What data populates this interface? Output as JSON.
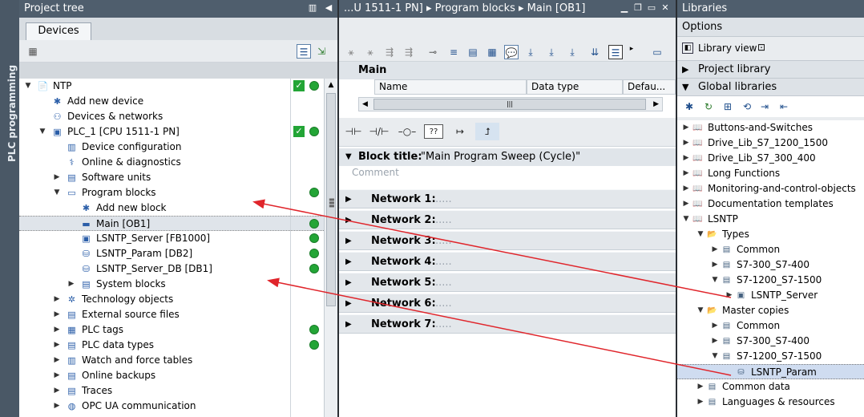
{
  "side_tab": "PLC programming",
  "project_tree": {
    "title": "Project tree",
    "tab": "Devices",
    "rows": [
      {
        "label": "NTP"
      },
      {
        "label": "Add new device"
      },
      {
        "label": "Devices & networks"
      },
      {
        "label": "PLC_1 [CPU 1511-1 PN]"
      },
      {
        "label": "Device configuration"
      },
      {
        "label": "Online & diagnostics"
      },
      {
        "label": "Software units"
      },
      {
        "label": "Program blocks"
      },
      {
        "label": "Add new block"
      },
      {
        "label": "Main [OB1]"
      },
      {
        "label": "LSNTP_Server [FB1000]"
      },
      {
        "label": "LSNTP_Param [DB2]"
      },
      {
        "label": "LSNTP_Server_DB [DB1]"
      },
      {
        "label": "System blocks"
      },
      {
        "label": "Technology objects"
      },
      {
        "label": "External source files"
      },
      {
        "label": "PLC tags"
      },
      {
        "label": "PLC data types"
      },
      {
        "label": "Watch and force tables"
      },
      {
        "label": "Online backups"
      },
      {
        "label": "Traces"
      },
      {
        "label": "OPC UA communication"
      }
    ]
  },
  "editor": {
    "breadcrumb": "...U 1511-1 PN]  ▸ Program blocks  ▸ Main [OB1]",
    "block": "Main",
    "columns": [
      "Name",
      "Data type",
      "Defau..."
    ],
    "block_title_label": "Block title:",
    "block_title_value": "\"Main Program Sweep (Cycle)\"",
    "comment": "Comment",
    "networks": [
      {
        "label": "Network 1:",
        "dots": "....."
      },
      {
        "label": "Network 2:",
        "dots": "....."
      },
      {
        "label": "Network 3:",
        "dots": "....."
      },
      {
        "label": "Network 4:",
        "dots": "....."
      },
      {
        "label": "Network 5:",
        "dots": "....."
      },
      {
        "label": "Network 6:",
        "dots": "....."
      },
      {
        "label": "Network 7:",
        "dots": "....."
      }
    ]
  },
  "libraries": {
    "title": "Libraries",
    "options": "Options",
    "library_view": "Library view",
    "project_library": "Project library",
    "global_libraries": "Global libraries",
    "rows": [
      {
        "label": "Buttons-and-Switches"
      },
      {
        "label": "Drive_Lib_S7_1200_1500"
      },
      {
        "label": "Drive_Lib_S7_300_400"
      },
      {
        "label": "Long Functions"
      },
      {
        "label": "Monitoring-and-control-objects"
      },
      {
        "label": "Documentation templates"
      },
      {
        "label": "LSNTP"
      },
      {
        "label": "Types"
      },
      {
        "label": "Common"
      },
      {
        "label": "S7-300_S7-400"
      },
      {
        "label": "S7-1200_S7-1500"
      },
      {
        "label": "LSNTP_Server"
      },
      {
        "label": "Master copies"
      },
      {
        "label": "Common"
      },
      {
        "label": "S7-300_S7-400"
      },
      {
        "label": "S7-1200_S7-1500"
      },
      {
        "label": "LSNTP_Param"
      },
      {
        "label": "Common data"
      },
      {
        "label": "Languages & resources"
      }
    ]
  },
  "colors": {
    "accent": "#4f5e6d",
    "status_green": "#23a536",
    "arrow": "#e0252b"
  }
}
